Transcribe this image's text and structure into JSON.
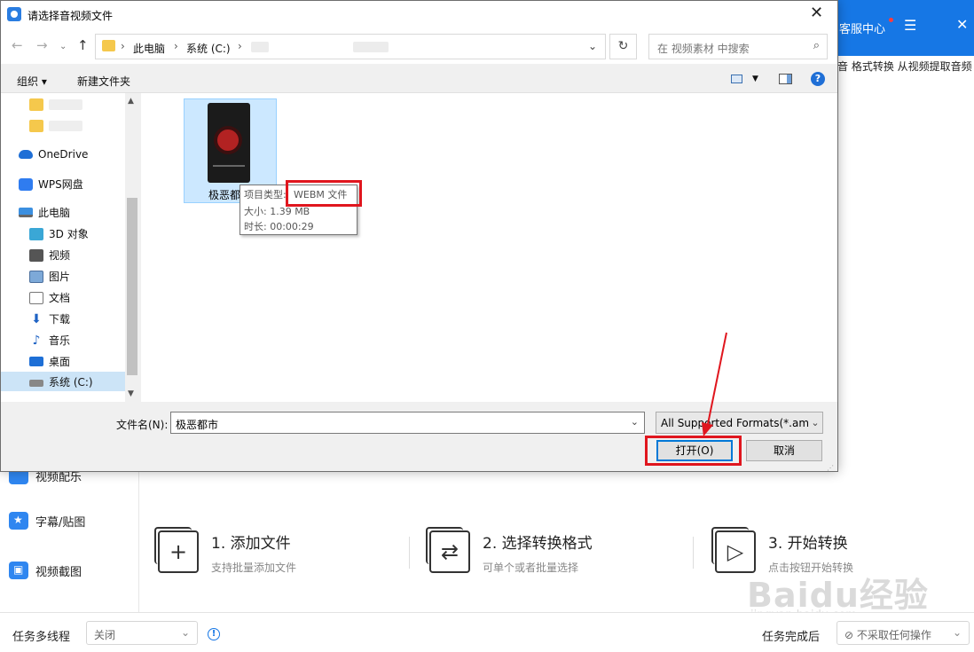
{
  "app": {
    "service_label": "客服中心",
    "subtabs_text": "音  格式转换  从视频提取音频",
    "sidebar": {
      "items": [
        {
          "label": "视频配乐",
          "icon": "music-video-icon"
        },
        {
          "label": "字幕/贴图",
          "icon": "star-icon"
        },
        {
          "label": "视频截图",
          "icon": "screenshot-icon"
        }
      ]
    },
    "steps": [
      {
        "title": "1. 添加文件",
        "desc": "支持批量添加文件",
        "icon": "add-file-icon"
      },
      {
        "title": "2. 选择转换格式",
        "desc": "可单个或者批量选择",
        "icon": "convert-icon"
      },
      {
        "title": "3. 开始转换",
        "desc": "点击按钮开始转换",
        "icon": "play-icon"
      }
    ],
    "bottom": {
      "multithread_label": "任务多线程",
      "multithread_value": "关闭",
      "after_label": "任务完成后",
      "after_value": "不采取任何操作"
    },
    "watermark": {
      "main": "Baidu经验",
      "sub": "jingyan.baidu.com"
    }
  },
  "dialog": {
    "title": "请选择音视频文件",
    "close_glyph": "✕",
    "address": {
      "crumbs": [
        "此电脑",
        "系统 (C:)"
      ]
    },
    "search_placeholder": "在 视频素材 中搜索",
    "toolbar": {
      "organize": "组织 ▾",
      "new_folder": "新建文件夹"
    },
    "nav_pane": {
      "items": [
        {
          "label": "OneDrive",
          "icon": "onedrive-icon"
        },
        {
          "label": "WPS网盘",
          "icon": "wps-cloud-icon"
        },
        {
          "label": "此电脑",
          "icon": "this-pc-icon"
        },
        {
          "label": "3D 对象",
          "icon": "3d-objects-icon"
        },
        {
          "label": "视频",
          "icon": "videos-folder-icon"
        },
        {
          "label": "图片",
          "icon": "pictures-folder-icon"
        },
        {
          "label": "文档",
          "icon": "documents-folder-icon"
        },
        {
          "label": "下载",
          "icon": "downloads-folder-icon"
        },
        {
          "label": "音乐",
          "icon": "music-folder-icon"
        },
        {
          "label": "桌面",
          "icon": "desktop-folder-icon"
        },
        {
          "label": "系统 (C:)",
          "icon": "drive-c-icon"
        }
      ]
    },
    "file": {
      "name": "极恶都市",
      "tooltip": {
        "type_label": "项目类型:",
        "type_value": "WEBM 文件",
        "size": "大小: 1.39 MB",
        "duration": "时长: 00:00:29"
      }
    },
    "filename_label": "文件名(N):",
    "filename_value": "极恶都市",
    "filetype_value": "All Supported Formats(*.amv",
    "open_button": "打开(O)",
    "cancel_button": "取消"
  },
  "colors": {
    "app_blue": "#1677e5",
    "highlight_red": "#e0161e",
    "selection_blue": "#cce8ff"
  }
}
